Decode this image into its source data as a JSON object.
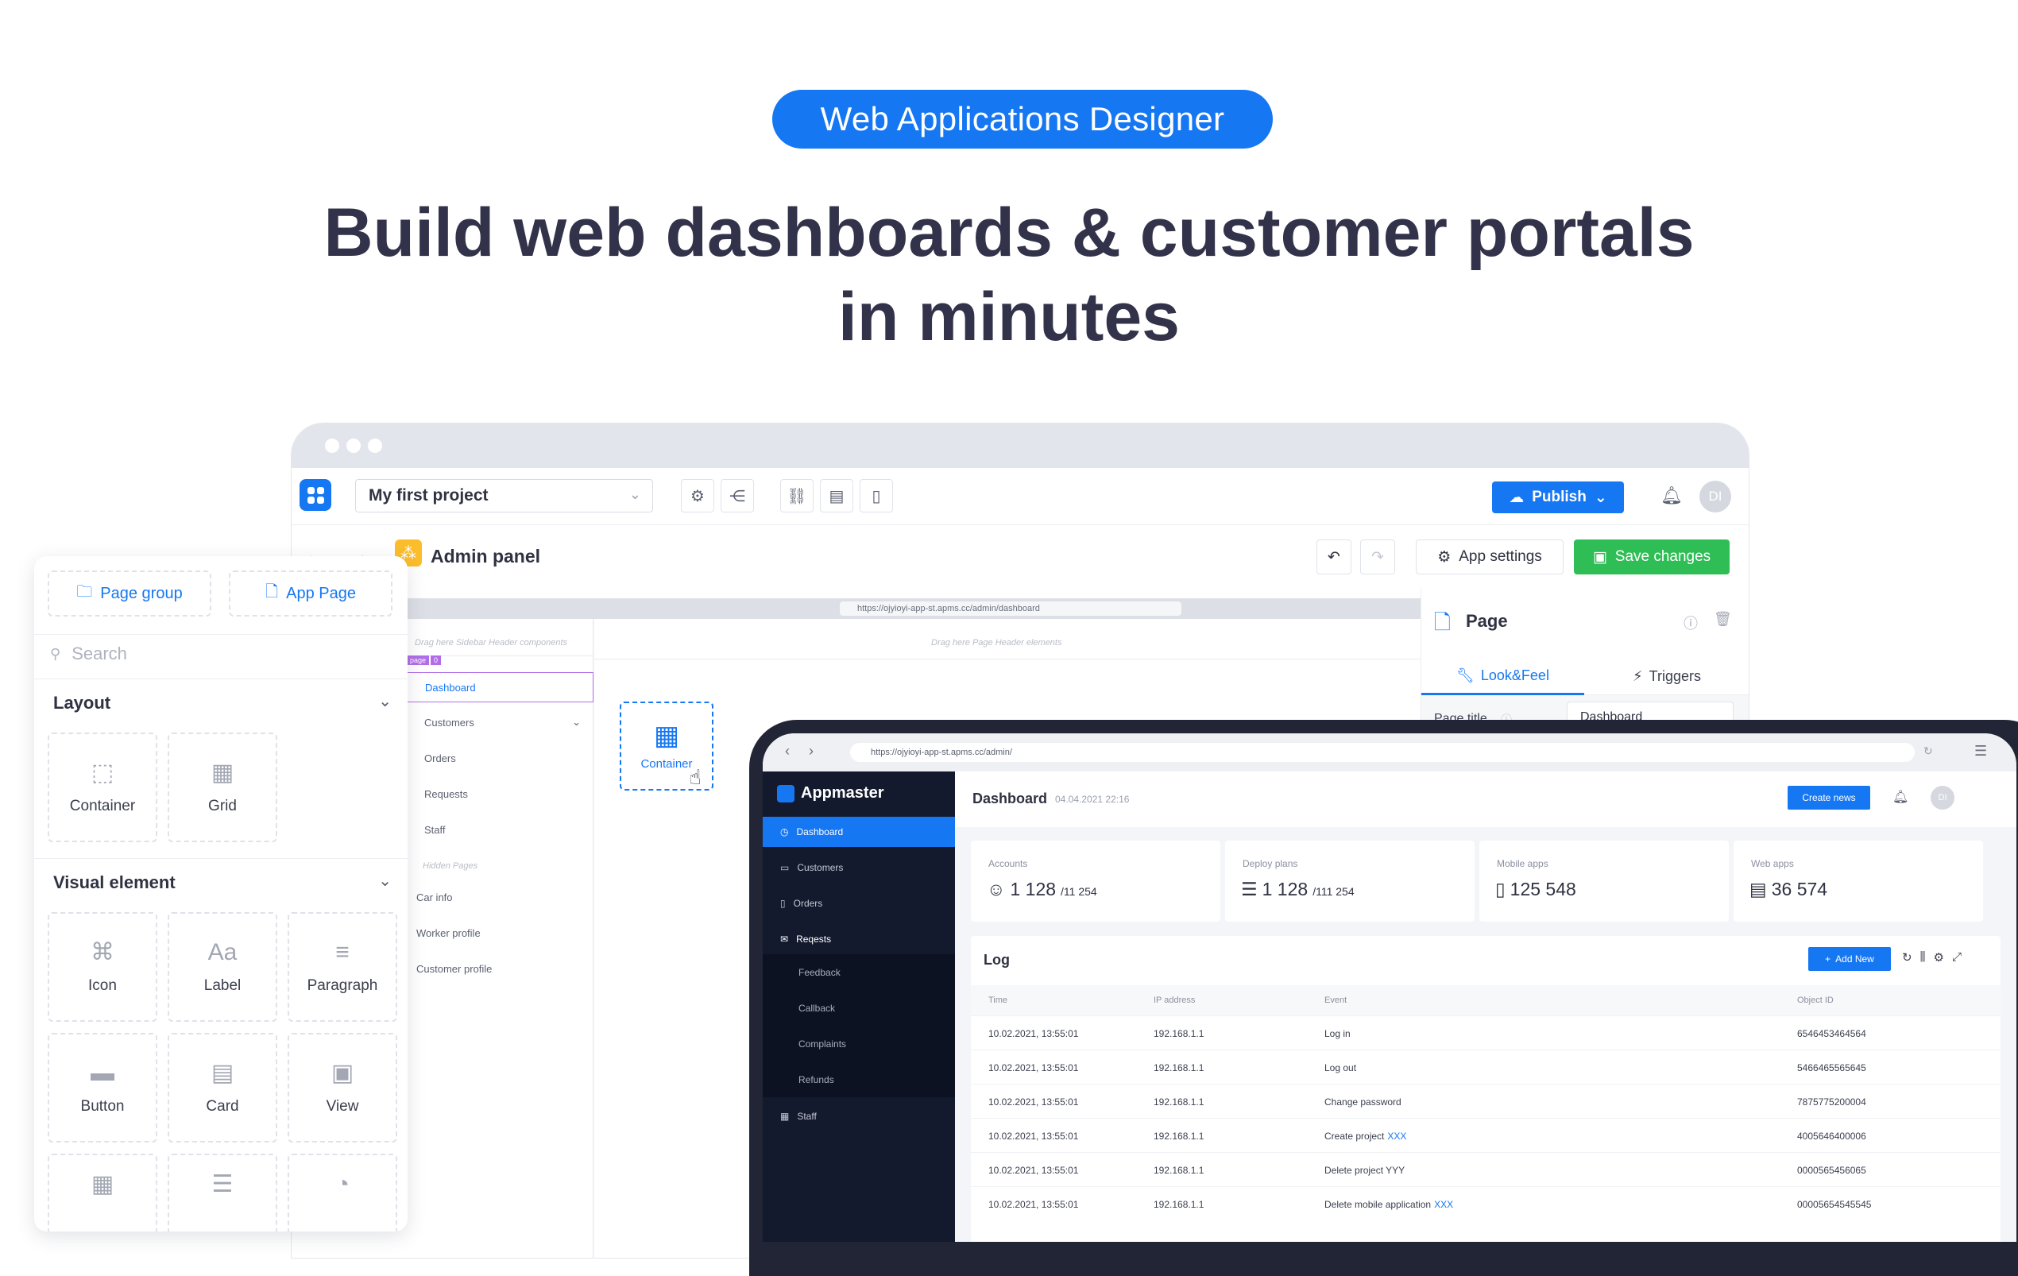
{
  "hero": {
    "badge": "Web Applications Designer",
    "headline_line1": "Build web dashboards & customer portals",
    "headline_line2": "in minutes"
  },
  "designer": {
    "project": "My first project",
    "publish_label": "Publish",
    "avatar": "DI",
    "page_title": "Admin panel",
    "app_settings_label": "App settings",
    "save_label": "Save changes",
    "url": "https://ojyioyi-app-st.apms.cc/admin/dashboard",
    "sidebar_hint": "Drag here Sidebar Header components",
    "header_hint": "Drag here Page Header elements",
    "tag_page": "page",
    "tag_num": "0",
    "nav": [
      "Dashboard",
      "Customers",
      "Orders",
      "Requests",
      "Staff"
    ],
    "hidden_pages_label": "Hidden Pages",
    "hidden_pages": [
      "Car info",
      "Worker profile",
      "Customer profile"
    ],
    "container_label": "Container",
    "props": {
      "title": "Page",
      "tab_look": "Look&Feel",
      "tab_triggers": "Triggers",
      "field_label": "Page title",
      "field_value": "Dashboard"
    }
  },
  "components": {
    "page_group": "Page group",
    "app_page": "App Page",
    "search_placeholder": "Search",
    "layout_title": "Layout",
    "layout_items": [
      "Container",
      "Grid"
    ],
    "visual_title": "Visual element",
    "visual_items": [
      "Icon",
      "Label",
      "Paragraph",
      "Button",
      "Card",
      "View"
    ]
  },
  "dashboard": {
    "url": "https://ojyioyi-app-st.apms.cc/admin/",
    "brand": "Appmaster",
    "title": "Dashboard",
    "date": "04.04.2021 22:16",
    "create_news": "Create news",
    "avatar": "DI",
    "sidebar": [
      "Dashboard",
      "Customers",
      "Orders",
      "Reqests"
    ],
    "sub_items": [
      "Feedback",
      "Callback",
      "Complaints",
      "Refunds"
    ],
    "staff": "Staff",
    "cards": [
      {
        "label": "Accounts",
        "value": "1 128",
        "sub": "/11 254"
      },
      {
        "label": "Deploy plans",
        "value": "1 128",
        "sub": "/111 254"
      },
      {
        "label": "Mobile apps",
        "value": "125 548",
        "sub": ""
      },
      {
        "label": "Web apps",
        "value": "36 574",
        "sub": ""
      }
    ],
    "log_title": "Log",
    "add_new": "Add New",
    "columns": [
      "Time",
      "IP address",
      "Event",
      "Object ID"
    ],
    "rows": [
      {
        "time": "10.02.2021, 13:55:01",
        "ip": "192.168.1.1",
        "event": "Log in",
        "event_link": "",
        "id": "6546453464564"
      },
      {
        "time": "10.02.2021, 13:55:01",
        "ip": "192.168.1.1",
        "event": "Log out",
        "event_link": "",
        "id": "5466465565645"
      },
      {
        "time": "10.02.2021, 13:55:01",
        "ip": "192.168.1.1",
        "event": "Change password",
        "event_link": "",
        "id": "7875775200004"
      },
      {
        "time": "10.02.2021, 13:55:01",
        "ip": "192.168.1.1",
        "event": "Create project",
        "event_link": "XXX",
        "id": "4005646400006"
      },
      {
        "time": "10.02.2021, 13:55:01",
        "ip": "192.168.1.1",
        "event": "Delete project YYY",
        "event_link": "",
        "id": "0000565456065"
      },
      {
        "time": "10.02.2021, 13:55:01",
        "ip": "192.168.1.1",
        "event": "Delete mobile application",
        "event_link": "XXX",
        "id": "00005654545545"
      }
    ]
  }
}
